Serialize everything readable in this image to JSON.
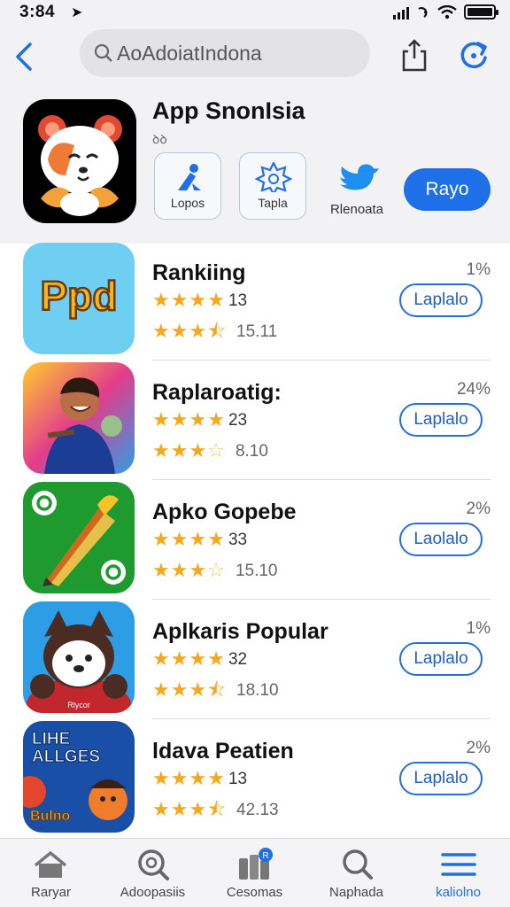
{
  "status_bar": {
    "time": "3:84",
    "location_glyph": "➤"
  },
  "nav": {
    "search_text": "AoAdoiatIndona",
    "back_icon": "chevron-left",
    "share_icon": "share",
    "refresh_icon": "refresh"
  },
  "featured": {
    "title": "App SnonIsia",
    "subtitle": "ꝺꝺ",
    "chips": [
      {
        "label": "Lopos",
        "icon": "a-logo"
      },
      {
        "label": "Tapla",
        "icon": "badge-star"
      }
    ],
    "plain_chip": {
      "label": "Rlenoata",
      "icon": "bird"
    },
    "get_label": "Rayo",
    "accent": "#1e6fe8"
  },
  "apps": [
    {
      "name": "Rankiing",
      "pct": "1%",
      "stars1": 4,
      "num1": "13",
      "stars2": 3.5,
      "num2": "15.11",
      "action": "Laplalo",
      "thumb_text": "Ppd"
    },
    {
      "name": "Raplaroatig:",
      "pct": "24%",
      "stars1": 4,
      "num1": "23",
      "stars2": 3,
      "num2": "8.10",
      "action": "Laplalo"
    },
    {
      "name": "Apko Gopebe",
      "pct": "2%",
      "stars1": 4,
      "num1": "33",
      "stars2": 3,
      "num2": "15.10",
      "action": "Laolalo"
    },
    {
      "name": "Aplkaris Popular",
      "pct": "1%",
      "stars1": 4,
      "num1": "32",
      "stars2": 3.5,
      "num2": "18.10",
      "action": "Laplalo",
      "thumb_text": "Rlycor"
    },
    {
      "name": "ldava Peatien",
      "pct": "2%",
      "stars1": 4,
      "num1": "13",
      "stars2": 3.5,
      "num2": "42.13",
      "action": "Laplalo",
      "thumb_text": "LIHE\nALLGES",
      "thumb_sub": "Bulno"
    }
  ],
  "tabs": [
    {
      "label": "Raryar",
      "icon": "home"
    },
    {
      "label": "Adoopasiis",
      "icon": "search-circle"
    },
    {
      "label": "Cesomas",
      "icon": "stack",
      "badge": "R"
    },
    {
      "label": "Naphada",
      "icon": "search"
    },
    {
      "label": "kaliolno",
      "icon": "menu",
      "active": true
    }
  ]
}
